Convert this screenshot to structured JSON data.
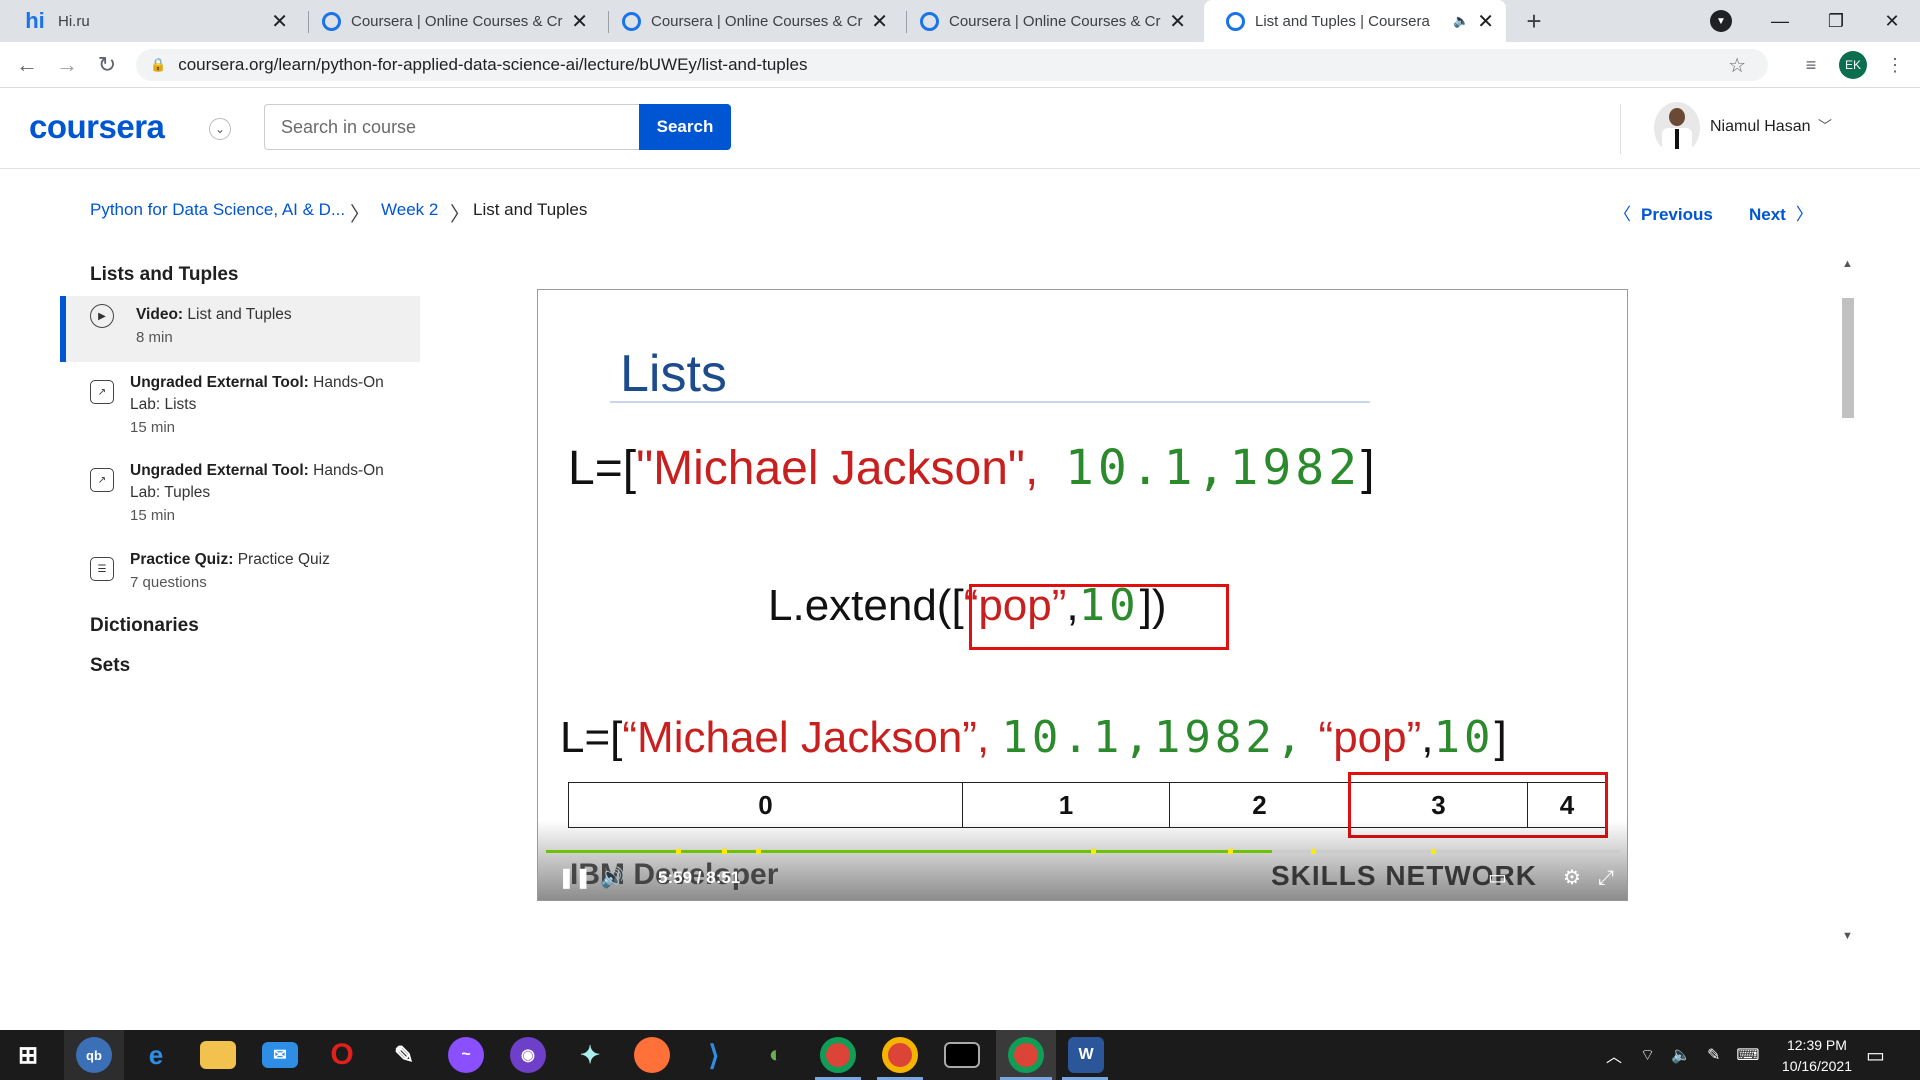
{
  "browser": {
    "tabs": [
      {
        "title": "Hi.ru",
        "favicon": "hi-icon"
      },
      {
        "title": "Coursera | Online Courses & Credentials",
        "favicon": "coursera-icon"
      },
      {
        "title": "Coursera | Online Courses & Credentials",
        "favicon": "coursera-icon"
      },
      {
        "title": "Coursera | Online Courses & Credentials",
        "favicon": "coursera-icon"
      },
      {
        "title": "List and Tuples | Coursera",
        "favicon": "coursera-icon",
        "active": true
      }
    ],
    "url": "coursera.org/learn/python-for-applied-data-science-ai/lecture/bUWEy/list-and-tuples",
    "profile_initials": "EK"
  },
  "header": {
    "logo": "coursera",
    "search_placeholder": "Search in course",
    "search_button": "Search",
    "user_name": "Niamul Hasan"
  },
  "breadcrumb": {
    "course": "Python for Data Science, AI & D...",
    "week": "Week 2",
    "current": "List and Tuples",
    "previous": "Previous",
    "next": "Next"
  },
  "sidebar": {
    "section_lists": "Lists and Tuples",
    "items": [
      {
        "type": "Video:",
        "title": "List and Tuples",
        "meta": "8 min"
      },
      {
        "type": "Ungraded External Tool:",
        "title": "Hands-On",
        "title2": "Lab: Lists",
        "meta": "15 min"
      },
      {
        "type": "Ungraded External Tool:",
        "title": "Hands-On",
        "title2": "Lab: Tuples",
        "meta": "15 min"
      },
      {
        "type": "Practice Quiz:",
        "title": "Practice Quiz",
        "meta": "7 questions"
      }
    ],
    "section_dicts": "Dictionaries",
    "section_sets": "Sets"
  },
  "video": {
    "slide_title": "Lists",
    "line1_prefix": "L=[",
    "line1_str": "\"Michael Jackson\",",
    "line1_nums": "10.1,1982",
    "line1_suffix": "]",
    "extend_prefix": "L.extend([",
    "extend_str": "“pop”",
    "extend_comma": ",",
    "extend_num": "10",
    "extend_suffix": "])",
    "line3_prefix": "L=[",
    "line3_str": "“Michael Jackson”,",
    "line3_nums": "10.1,1982,",
    "line3_pop": "“pop”",
    "line3_comma": ",",
    "line3_num": "10",
    "line3_suffix": "]",
    "indices": [
      "0",
      "1",
      "2",
      "3",
      "4"
    ],
    "brand_left": "IBM Developer",
    "brand_right": "SKILLS NETWORK",
    "time_current": "5:59",
    "time_sep": "/",
    "time_total": "8:51",
    "progress_fraction": 0.676
  },
  "taskbar": {
    "apps": [
      "qb",
      "edge",
      "file-explorer",
      "mail",
      "opera",
      "inkscape",
      "messenger",
      "github",
      "app",
      "firefox",
      "vscode",
      "app2",
      "chrome",
      "chrome2",
      "terminal",
      "chrome-ek",
      "word"
    ],
    "time": "12:39 PM",
    "date": "10/16/2021"
  },
  "colors": {
    "coursera_blue": "#0056d2",
    "slide_red": "#c8201f",
    "slide_green": "#2b8a2b",
    "progress_green": "#6ec300"
  }
}
